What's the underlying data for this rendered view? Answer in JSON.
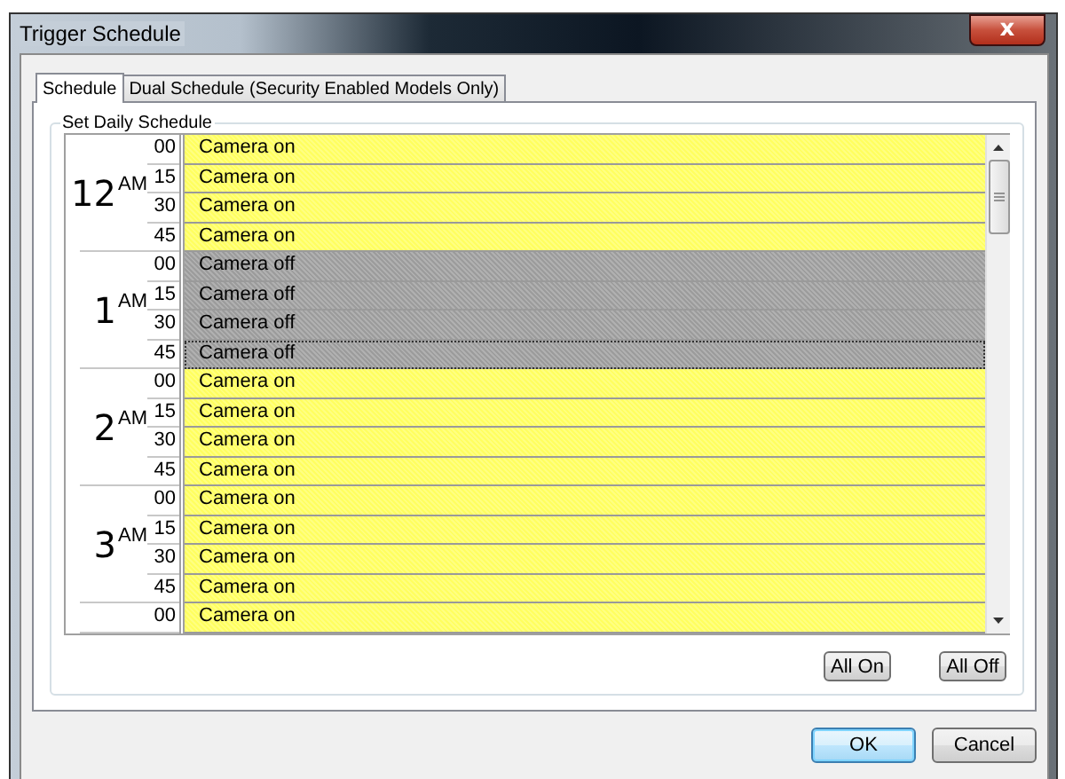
{
  "window": {
    "title": "Trigger Schedule",
    "close_label": "x"
  },
  "tabs": [
    {
      "label": "Schedule",
      "selected": true
    },
    {
      "label": "Dual Schedule (Security Enabled Models Only)",
      "selected": false
    }
  ],
  "group": {
    "title": "Set Daily Schedule"
  },
  "hours": [
    {
      "label": "12",
      "period": "AM",
      "slots": [
        {
          "minute": "00",
          "status": "Camera on",
          "on": true,
          "focused": false
        },
        {
          "minute": "15",
          "status": "Camera on",
          "on": true,
          "focused": false
        },
        {
          "minute": "30",
          "status": "Camera on",
          "on": true,
          "focused": false
        },
        {
          "minute": "45",
          "status": "Camera on",
          "on": true,
          "focused": false
        }
      ]
    },
    {
      "label": "1",
      "period": "AM",
      "slots": [
        {
          "minute": "00",
          "status": "Camera off",
          "on": false,
          "focused": false
        },
        {
          "minute": "15",
          "status": "Camera off",
          "on": false,
          "focused": false
        },
        {
          "minute": "30",
          "status": "Camera off",
          "on": false,
          "focused": false
        },
        {
          "minute": "45",
          "status": "Camera off",
          "on": false,
          "focused": true
        }
      ]
    },
    {
      "label": "2",
      "period": "AM",
      "slots": [
        {
          "minute": "00",
          "status": "Camera on",
          "on": true,
          "focused": false
        },
        {
          "minute": "15",
          "status": "Camera on",
          "on": true,
          "focused": false
        },
        {
          "minute": "30",
          "status": "Camera on",
          "on": true,
          "focused": false
        },
        {
          "minute": "45",
          "status": "Camera on",
          "on": true,
          "focused": false
        }
      ]
    },
    {
      "label": "3",
      "period": "AM",
      "slots": [
        {
          "minute": "00",
          "status": "Camera on",
          "on": true,
          "focused": false
        },
        {
          "minute": "15",
          "status": "Camera on",
          "on": true,
          "focused": false
        },
        {
          "minute": "30",
          "status": "Camera on",
          "on": true,
          "focused": false
        },
        {
          "minute": "45",
          "status": "Camera on",
          "on": true,
          "focused": false
        }
      ]
    },
    {
      "slots": [
        {
          "minute": "00",
          "status": "Camera on",
          "on": true,
          "focused": false
        }
      ]
    }
  ],
  "schedule_buttons": [
    "All On",
    "All Off"
  ],
  "dialog_buttons": [
    {
      "label": "OK",
      "default": true
    },
    {
      "label": "Cancel",
      "default": false
    }
  ]
}
